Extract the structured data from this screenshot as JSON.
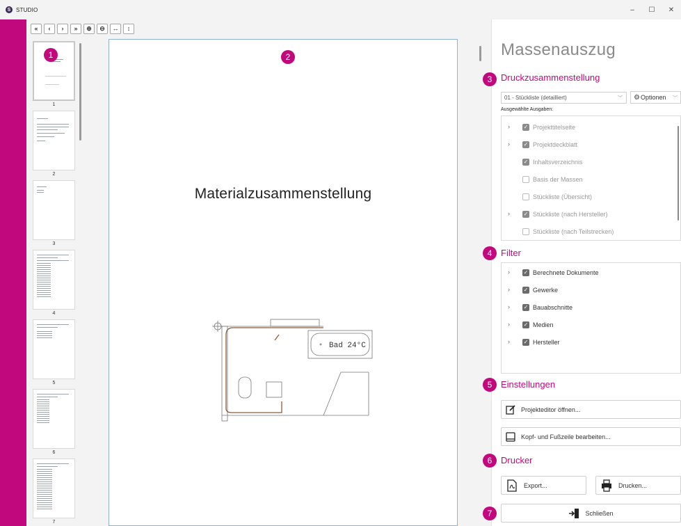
{
  "app": {
    "title": "STUDIO",
    "logo_letter": "S"
  },
  "window_controls": {
    "minimize": "–",
    "maximize": "☐",
    "close": "✕"
  },
  "toolbar": [
    {
      "name": "first-page-button",
      "icon": "«"
    },
    {
      "name": "prev-page-button",
      "icon": "‹"
    },
    {
      "name": "next-page-button",
      "icon": "›"
    },
    {
      "name": "last-page-button",
      "icon": "»"
    },
    {
      "name": "zoom-in-button",
      "icon": "⊕"
    },
    {
      "name": "zoom-out-button",
      "icon": "⊖"
    },
    {
      "name": "fit-width-button",
      "icon": "↔"
    },
    {
      "name": "fit-height-button",
      "icon": "↕"
    }
  ],
  "thumbnails": {
    "pages": [
      "1",
      "2",
      "3",
      "4",
      "5",
      "6",
      "7"
    ],
    "selected": "1"
  },
  "badges": {
    "b1": "1",
    "b2": "2",
    "b3": "3",
    "b4": "4",
    "b5": "5",
    "b6": "6",
    "b7": "7"
  },
  "preview": {
    "page_title": "Materialzusammenstellung",
    "room_label": "Bad 24°C"
  },
  "right_panel": {
    "title": "Massenauszug",
    "print_composition": {
      "heading": "Druckzusammenstellung",
      "selected_preset": "01 - Stückliste (detailliert)",
      "options_label": "Optionen",
      "outputs_label": "Ausgewählte Ausgaben:",
      "items": [
        {
          "label": "Projekttitelseite",
          "expandable": true,
          "checked": true,
          "enabled": false
        },
        {
          "label": "Projektdeckblatt",
          "expandable": true,
          "checked": true,
          "enabled": false
        },
        {
          "label": "Inhaltsverzeichnis",
          "expandable": false,
          "checked": true,
          "enabled": false
        },
        {
          "label": "Basis der Massen",
          "expandable": false,
          "checked": false,
          "enabled": false
        },
        {
          "label": "Stückliste (Übersicht)",
          "expandable": false,
          "checked": false,
          "enabled": false
        },
        {
          "label": "Stückliste (nach Hersteller)",
          "expandable": true,
          "checked": true,
          "enabled": false
        },
        {
          "label": "Stückliste (nach Teilstrecken)",
          "expandable": false,
          "checked": false,
          "enabled": false
        }
      ]
    },
    "filter": {
      "heading": "Filter",
      "items": [
        {
          "label": "Berechnete Dokumente",
          "checked": true
        },
        {
          "label": "Gewerke",
          "checked": true
        },
        {
          "label": "Bauabschnitte",
          "checked": true
        },
        {
          "label": "Medien",
          "checked": true
        },
        {
          "label": "Hersteller",
          "checked": true
        }
      ]
    },
    "settings": {
      "heading": "Einstellungen",
      "project_editor": "Projekteditor öffnen...",
      "header_footer": "Kopf- und Fußzeile bearbeiten..."
    },
    "printer": {
      "heading": "Drucker",
      "export": "Export...",
      "print": "Drucken..."
    },
    "close": "Schließen"
  },
  "colors": {
    "accent": "#c2087d",
    "title_gray": "#8a8a8a"
  }
}
